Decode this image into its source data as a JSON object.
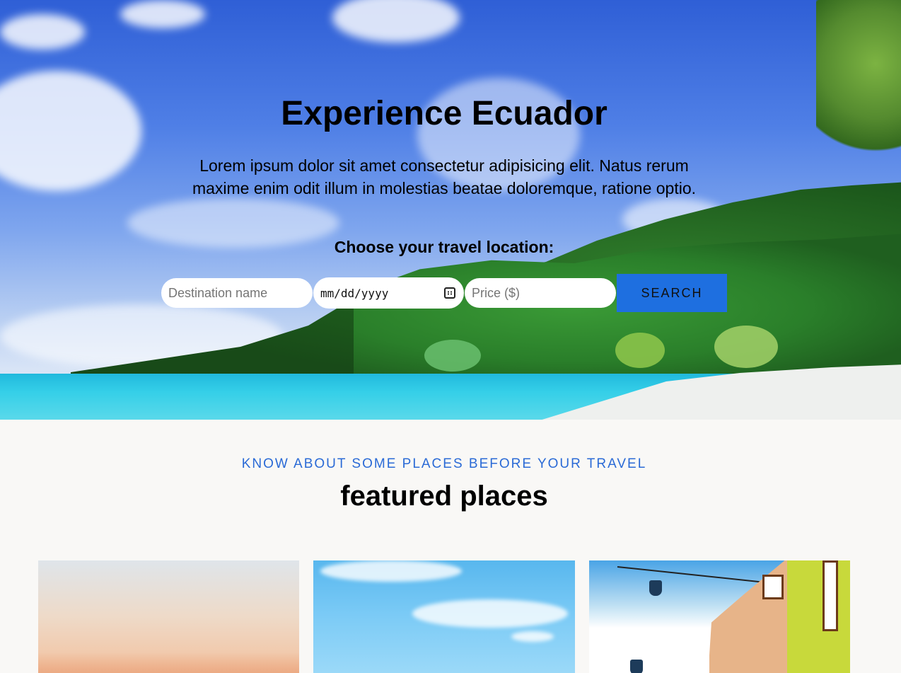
{
  "hero": {
    "title": "Experience Ecuador",
    "text": "Lorem ipsum dolor sit amet consectetur adipisicing elit. Natus rerum maxime enim odit illum in molestias beatae doloremque, ratione optio.",
    "choose_label": "Choose your travel location:"
  },
  "search": {
    "destination_placeholder": "Destination name",
    "date_placeholder": "mm/dd/yyyy",
    "price_placeholder": "Price ($)",
    "button_label": "SEARCH"
  },
  "featured": {
    "kicker": "KNOW ABOUT SOME PLACES BEFORE YOUR TRAVEL",
    "title": "featured places"
  },
  "colors": {
    "accent": "#1e6fe0",
    "kicker": "#2a6ad6",
    "background": "#f9f8f6"
  },
  "icons": {
    "date_picker": "calendar-icon"
  }
}
